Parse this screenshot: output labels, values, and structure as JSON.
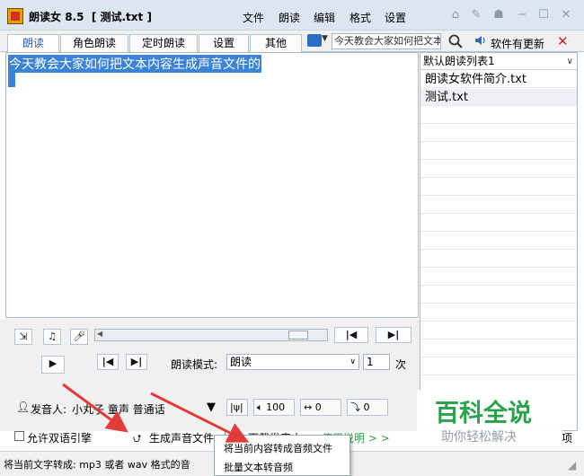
{
  "window": {
    "app_name": "朗读女",
    "version": "8.5",
    "document_label": "[ 测试.txt ]"
  },
  "menu": [
    "文件",
    "朗读",
    "编辑",
    "格式",
    "设置"
  ],
  "window_controls": [
    "home-icon",
    "tools-icon",
    "shirt-icon",
    "minimize-icon",
    "maximize-icon",
    "close-icon"
  ],
  "tabs": [
    "朗读",
    "角色朗读",
    "定时朗读",
    "设置",
    "其他"
  ],
  "toolbar": {
    "search_value": "今天教会大家如何把文本",
    "update_label": "软件有更新",
    "close_mark": "✕"
  },
  "editor": {
    "text": "今天教会大家如何把文本内容生成声音文件的"
  },
  "playlist": {
    "selected": "默认朗读列表1",
    "items": [
      "朗读女软件简介.txt",
      "测试.txt"
    ]
  },
  "player": {
    "mode_label": "朗读模式:",
    "mode_value": "朗读",
    "count_value": "1",
    "count_unit": "次",
    "progress": 0.92
  },
  "speaker": {
    "label": "发音人:",
    "value": "小丸子 童声 普通话"
  },
  "params": {
    "volume": "100",
    "speed": "0",
    "pitch": "0"
  },
  "options": {
    "bilingual_engine": "允许双语引擎",
    "generate_audio": "生成声音文件",
    "download_voice_partial": "下载发音人",
    "usage_help": "使用说明 > >",
    "cut_off_suffix": "项"
  },
  "status": {
    "text": "将当前文字转成: mp3 或者 wav 格式的音"
  },
  "dropdown_menu": [
    "将当前内容转成音频文件",
    "批量文本转音频"
  ],
  "watermark": {
    "title": "百科全说",
    "subtitle": "助你轻松解决"
  },
  "colors": {
    "selection": "#3b83d8",
    "tab_active_text": "#2a5bb5",
    "watermark_green": "#2ba24c",
    "annotation_arrow": "#e33a3a"
  }
}
